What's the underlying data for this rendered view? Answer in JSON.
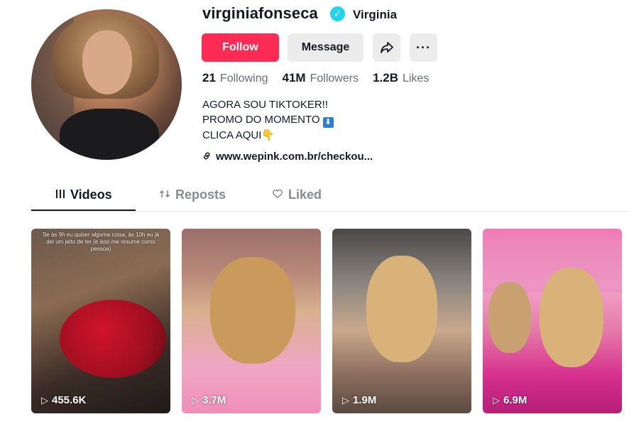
{
  "profile": {
    "username": "virginiafonseca",
    "nickname": "Virginia",
    "verified_icon": "verified-badge-icon",
    "avatar_desc": "profile-avatar"
  },
  "actions": {
    "follow_label": "Follow",
    "message_label": "Message",
    "share_icon": "share-arrow-icon",
    "more_icon": "more-dots-icon",
    "more_glyph": "···",
    "share_glyph": "➦"
  },
  "stats": [
    {
      "value": "21",
      "label": "Following"
    },
    {
      "value": "41M",
      "label": "Followers"
    },
    {
      "value": "1.2B",
      "label": "Likes"
    }
  ],
  "bio": {
    "line1": "AGORA SOU TIKTOKER!!",
    "line2": "PROMO DO MOMENTO",
    "line2_emoji": "⬇",
    "line3": "CLICA AQUI👇",
    "link": "www.wepink.com.br/checkou..."
  },
  "tabs": [
    {
      "label": "Videos",
      "icon": "grid-icon",
      "glyph": "⦙⦙⦙"
    },
    {
      "label": "Reposts",
      "icon": "repost-icon",
      "glyph": "⇅"
    },
    {
      "label": "Liked",
      "icon": "heart-icon",
      "glyph": "♡"
    }
  ],
  "videos": [
    {
      "views": "455.6K",
      "caption": "Se às 9h eu quiser alguma coisa, às 10h eu já dei um jeito de ter (e isso me resume como pessoa)"
    },
    {
      "views": "3.7M"
    },
    {
      "views": "1.9M"
    },
    {
      "views": "6.9M"
    }
  ],
  "colors": {
    "follow_bg": "#fe2c55",
    "verified": "#20d5ec",
    "secondary_btn": "#ececec"
  }
}
